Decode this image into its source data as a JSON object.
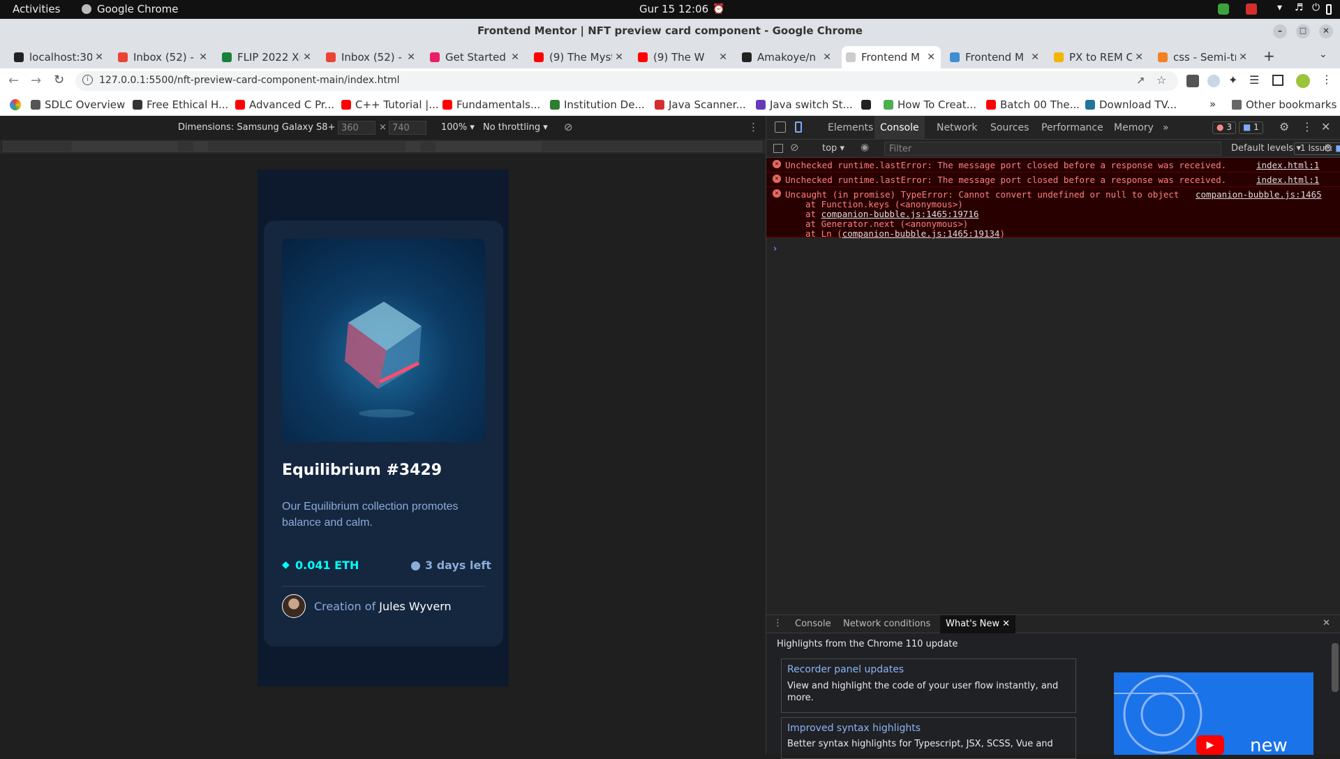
{
  "system": {
    "activities": "Activities",
    "app": "Google Chrome",
    "datetime": "Gur 15  12:06"
  },
  "window": {
    "title": "Frontend Mentor | NFT preview card component - Google Chrome"
  },
  "tabs": [
    {
      "label": "localhost:30",
      "color": "#222222"
    },
    {
      "label": "Inbox (52) - c",
      "color": "#ea4335"
    },
    {
      "label": "FLIP 2022 Xn",
      "color": "#188038"
    },
    {
      "label": "Inbox (52) - c",
      "color": "#ea4335"
    },
    {
      "label": "Get Started",
      "color": "#e91e63"
    },
    {
      "label": "(9) The Myst",
      "color": "#ff0000"
    },
    {
      "label": "(9) The W",
      "color": "#ff0000"
    },
    {
      "label": "Amakoye/n",
      "color": "#222222"
    },
    {
      "label": "Frontend M",
      "color": "#cccccc"
    },
    {
      "label": "Frontend M",
      "color": "#3e8ed0"
    },
    {
      "label": "PX to REM C",
      "color": "#f4b400"
    },
    {
      "label": "css - Semi-tr",
      "color": "#f48024"
    }
  ],
  "address": {
    "url": "127.0.0.1:5500/nft-preview-card-component-main/index.html"
  },
  "bookmarks": [
    {
      "label": "SDLC Overview",
      "color": "#555555"
    },
    {
      "label": "Free Ethical H...",
      "color": "#333333"
    },
    {
      "label": "Advanced C Pr...",
      "color": "#ff0000"
    },
    {
      "label": "C++ Tutorial |...",
      "color": "#ff0000"
    },
    {
      "label": "Fundamentals...",
      "color": "#ff0000"
    },
    {
      "label": "Institution De...",
      "color": "#2e7d32"
    },
    {
      "label": "Java Scanner...",
      "color": "#d32f2f"
    },
    {
      "label": "Java switch St...",
      "color": "#673ab7"
    },
    {
      "label": "",
      "color": "#222222"
    },
    {
      "label": "How To Creat...",
      "color": "#4caf50"
    },
    {
      "label": "Batch 00 The...",
      "color": "#ff0000"
    },
    {
      "label": "Download TV...",
      "color": "#21759b"
    }
  ],
  "bookmarks_other": "Other bookmarks",
  "device_toolbar": {
    "dimensions": "Dimensions: Samsung Galaxy S8+",
    "width": "360",
    "height": "740",
    "zoom": "100%",
    "throttling": "No throttling"
  },
  "card": {
    "title": "Equilibrium #3429",
    "description": "Our Equilibrium collection promotes balance and calm.",
    "price": "0.041 ETH",
    "time_left": "3 days left",
    "creation_prefix": "Creation of",
    "creator": "Jules Wyvern",
    "colors": {
      "cyan": "#00fff8",
      "soft_blue": "#8bacd9",
      "card_bg": "#15263f",
      "main_bg": "#0d1a2d"
    }
  },
  "devtools": {
    "tabs": [
      "Elements",
      "Console",
      "Network",
      "Sources",
      "Performance",
      "Memory"
    ],
    "error_count": "3",
    "message_count": "1",
    "context": "top",
    "filter_placeholder": "Filter",
    "levels": "Default levels",
    "issues": "1 Issue:",
    "issues_count": "1",
    "errors": [
      {
        "text": "Unchecked runtime.lastError: The message port closed before a response was received.",
        "source": "index.html:1"
      },
      {
        "text": "Unchecked runtime.lastError: The message port closed before a response was received.",
        "source": "index.html:1"
      }
    ],
    "error3": {
      "text": "Uncaught (in promise) TypeError: Cannot convert undefined or null to object",
      "source": "companion-bubble.js:1465",
      "stack1": "at Function.keys (<anonymous>)",
      "stack2_prefix": "at",
      "stack2_link": "companion-bubble.js:1465:19716",
      "stack3": "at Generator.next (<anonymous>)",
      "stack4_prefix": "at Ln (",
      "stack4_link": "companion-bubble.js:1465:19134",
      "stack4_suffix": ")"
    },
    "drawer": {
      "tabs": [
        "Console",
        "Network conditions",
        "What's New"
      ],
      "headline": "Highlights from the Chrome 110 update",
      "item1_title": "Recorder panel updates",
      "item1_body": "View and highlight the code of your user flow instantly, and more.",
      "item2_title": "Improved syntax highlights",
      "item2_body": "Better syntax highlights for Typescript, JSX, SCSS, Vue and",
      "video_label": "new"
    }
  }
}
